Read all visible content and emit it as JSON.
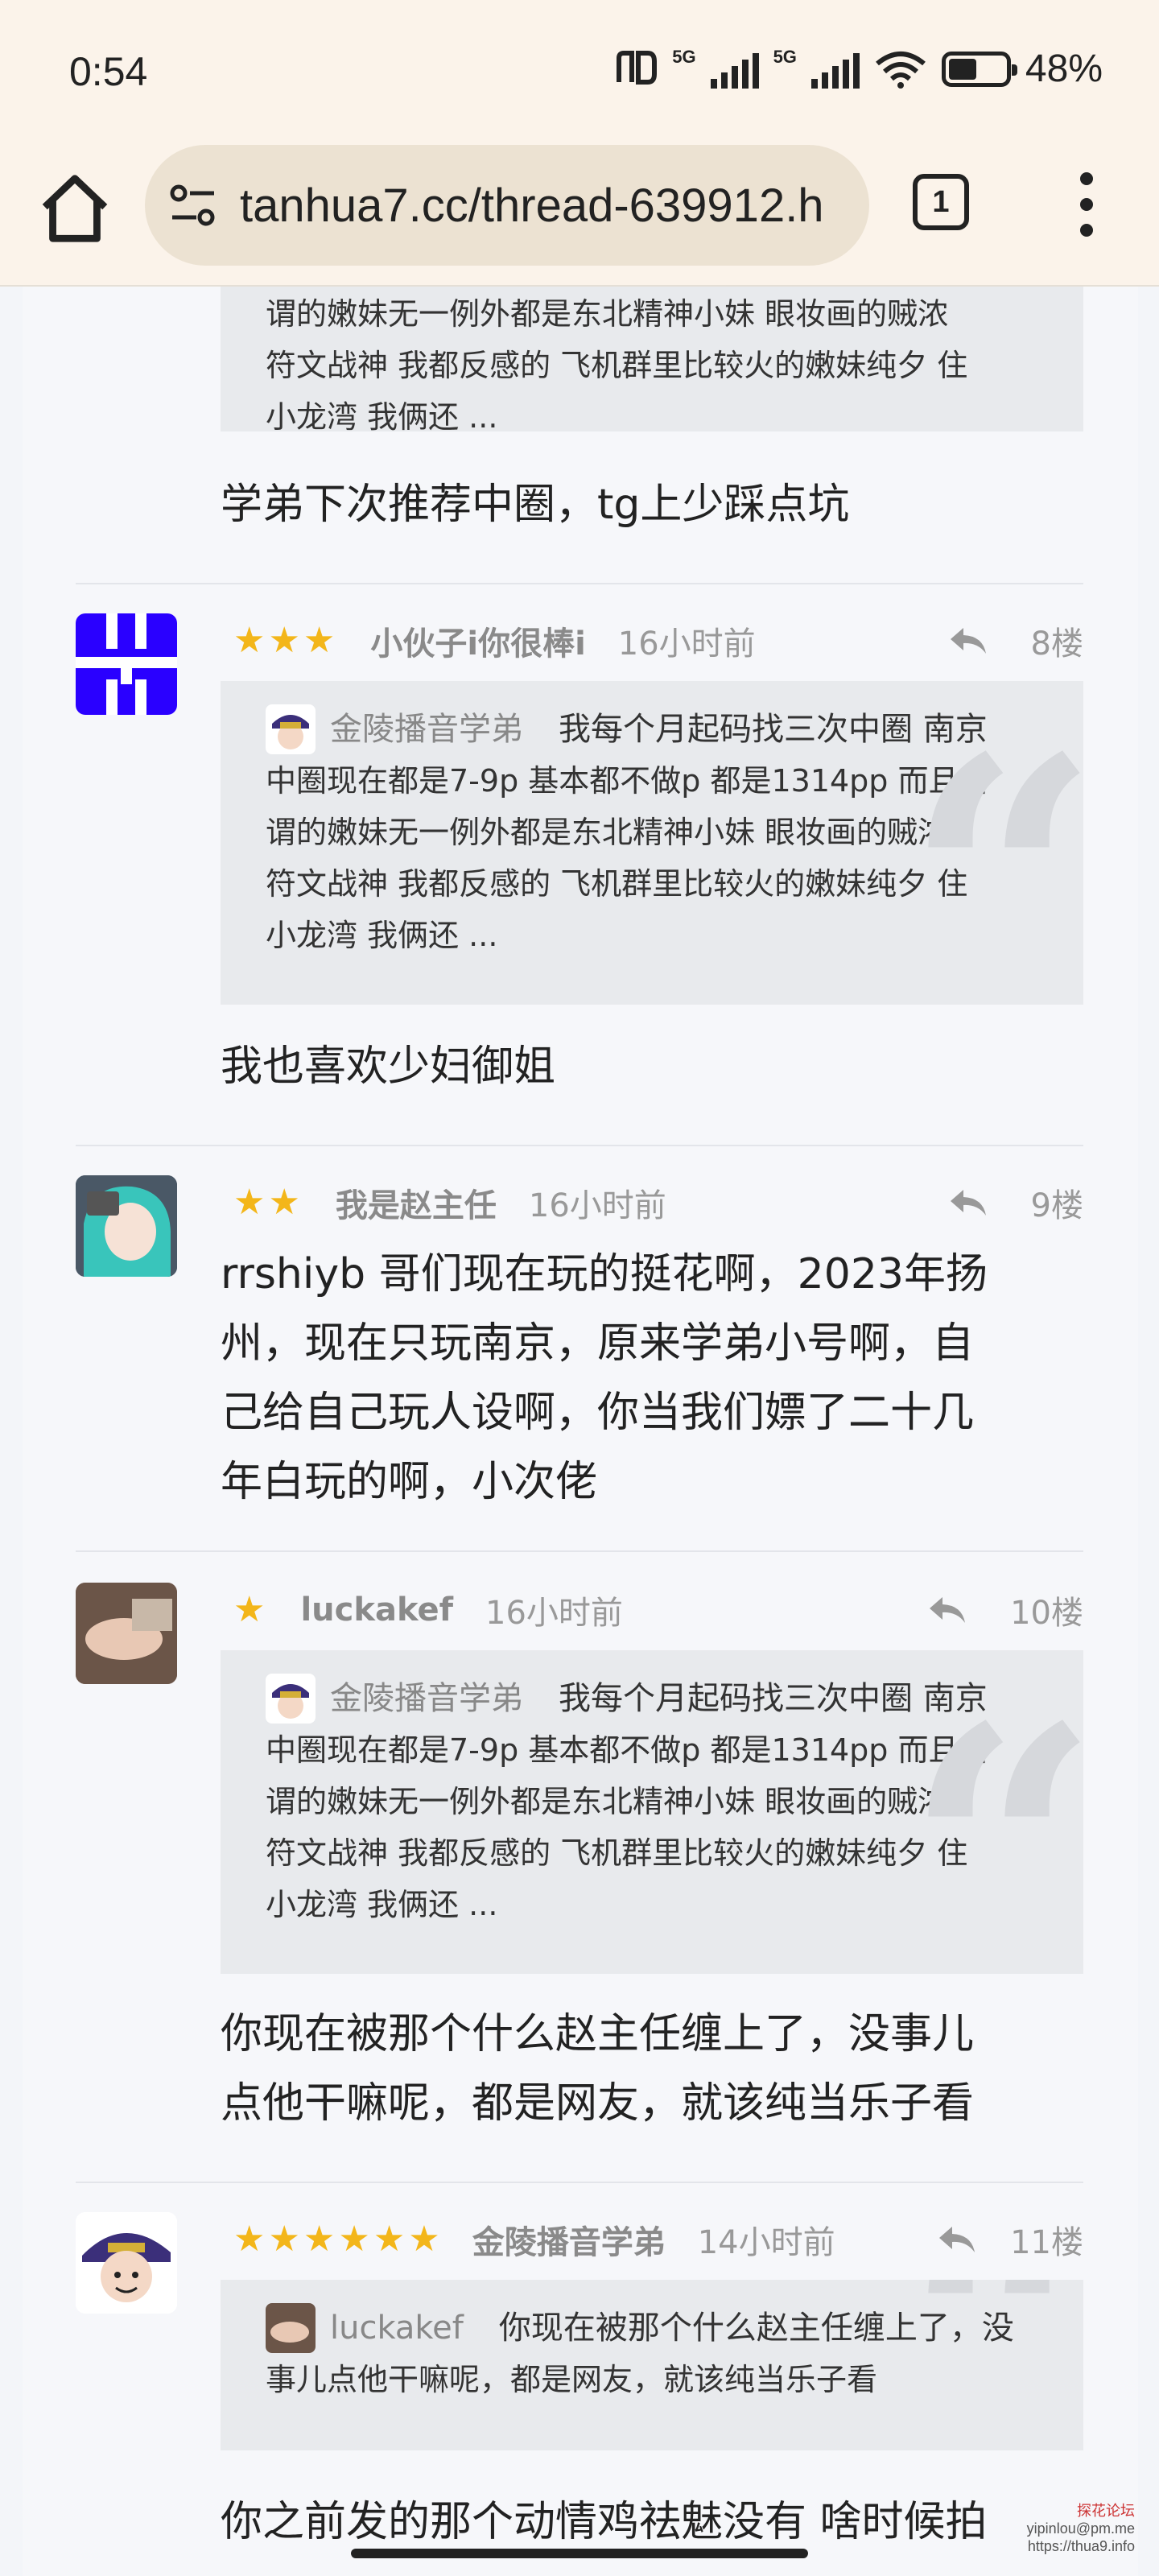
{
  "status": {
    "time": "0:54",
    "net1": "5G",
    "net2": "5G",
    "battery": "48%"
  },
  "browser": {
    "url": "tanhua7.cc/thread-639912.h",
    "tab_count": "1"
  },
  "quote_full": "我每个月起码找三次中圈 南京中圈现在都是7-9p 基本都不做p 都是1314pp 而且所谓的嫩妹无一例外都是东北精神小妹 眼妆画的贼浓 符文战神 我都反感的 飞机群里比较火的嫩妹纯夕 住小龙湾 我俩还 ...",
  "top_partial": {
    "quote_lines": [
      "谓的嫩妹无一例外都是东北精神小妹 眼妆画的贼浓",
      "符文战神 我都反感的 飞机群里比较火的嫩妹纯夕 住",
      "小龙湾 我俩还 ..."
    ],
    "reply": "学弟下次推荐中圈，tg上少踩点坑"
  },
  "posts": [
    {
      "user": "小伙子i你很棒i",
      "time": "16小时前",
      "floor": "8楼",
      "stars": 3,
      "quote": {
        "user": "金陵播音学弟",
        "lines": [
          "我每个月起码找三次中圈 南京",
          "中圈现在都是7-9p 基本都不做p 都是1314pp 而且所",
          "谓的嫩妹无一例外都是东北精神小妹 眼妆画的贼浓",
          "符文战神 我都反感的 飞机群里比较火的嫩妹纯夕 住",
          "小龙湾 我俩还 ..."
        ]
      },
      "body": [
        "我也喜欢少妇御姐"
      ]
    },
    {
      "user": "我是赵主任",
      "time": "16小时前",
      "floor": "9楼",
      "stars": 2,
      "body": [
        "rrshiyb  哥们现在玩的挺花啊，2023年扬",
        "州，现在只玩南京，原来学弟小号啊，自",
        "己给自己玩人设啊，你当我们嫖了二十几",
        "年白玩的啊，小次佬"
      ]
    },
    {
      "user": "luckakef",
      "time": "16小时前",
      "floor": "10楼",
      "stars": 1,
      "quote": {
        "user": "金陵播音学弟",
        "lines": [
          "我每个月起码找三次中圈 南京",
          "中圈现在都是7-9p 基本都不做p 都是1314pp 而且所",
          "谓的嫩妹无一例外都是东北精神小妹 眼妆画的贼浓",
          "符文战神 我都反感的 飞机群里比较火的嫩妹纯夕 住",
          "小龙湾 我俩还 ..."
        ]
      },
      "body": [
        "你现在被那个什么赵主任缠上了，没事儿",
        "点他干嘛呢，都是网友，就该纯当乐子看"
      ]
    },
    {
      "user": "金陵播音学弟",
      "time": "14小时前",
      "floor": "11楼",
      "stars": 6,
      "quote": {
        "user": "luckakef",
        "lines": [
          "你现在被那个什么赵主任缠上了，没",
          "事儿点他干嘛呢，都是网友，就该纯当乐子看"
        ]
      },
      "body": [
        "你之前发的那个动情鸡祛魅没有 啥时候拍"
      ]
    }
  ],
  "watermark": {
    "line1": "探花论坛",
    "line2": "yipinlou@pm.me",
    "line3": "https://thua9.info"
  },
  "colors": {
    "star": "#f3b61a",
    "quote_bg": "#e8eaed",
    "status_bg": "#fbf3ea"
  }
}
